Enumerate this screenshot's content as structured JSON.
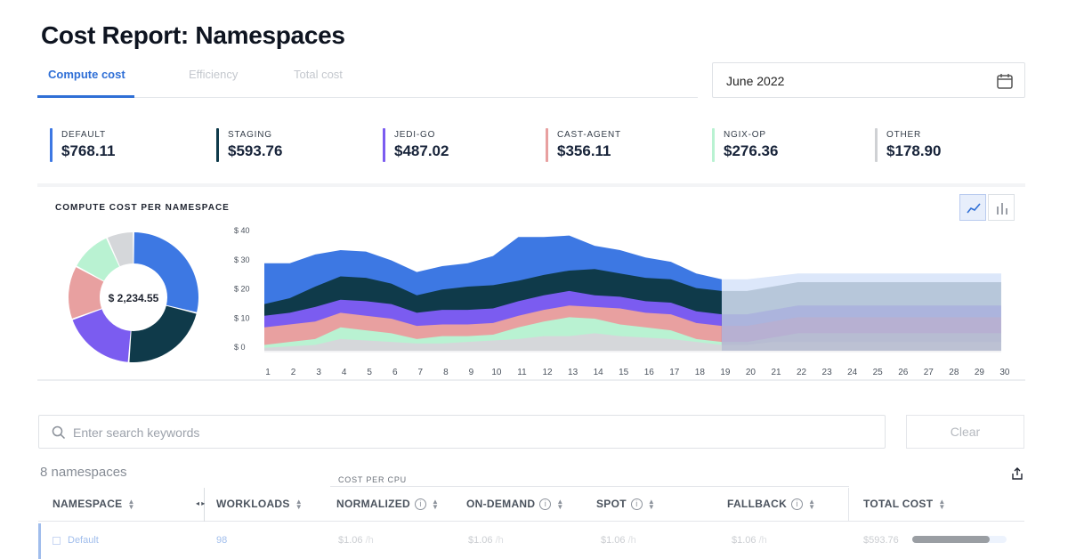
{
  "page": {
    "title": "Cost Report: Namespaces"
  },
  "tabs": [
    {
      "label": "Compute cost",
      "active": true
    },
    {
      "label": "Efficiency",
      "active": false
    },
    {
      "label": "Total cost",
      "active": false
    }
  ],
  "date_picker": {
    "value": "June 2022",
    "icon": "calendar-icon"
  },
  "summary": [
    {
      "label": "DEFAULT",
      "amount": "$768.11",
      "color": "#3d78e3"
    },
    {
      "label": "STAGING",
      "amount": "$593.76",
      "color": "#0f3a4a"
    },
    {
      "label": "JEDI-GO",
      "amount": "$487.02",
      "color": "#7b5cf0"
    },
    {
      "label": "CAST-AGENT",
      "amount": "$356.11",
      "color": "#e8a0a0"
    },
    {
      "label": "NGIX-OP",
      "amount": "$276.36",
      "color": "#b9f2d2"
    },
    {
      "label": "OTHER",
      "amount": "$178.90",
      "color": "#cfd1d4"
    }
  ],
  "chart": {
    "title": "COMPUTE COST PER NAMESPACE",
    "total_label": "$ 2,234.55",
    "toggles": [
      {
        "name": "line-chart-toggle",
        "icon": "line-chart-icon",
        "active": true
      },
      {
        "name": "bar-chart-toggle",
        "icon": "bar-chart-icon",
        "active": false
      }
    ]
  },
  "chart_data": [
    {
      "type": "pie",
      "variant": "donut",
      "center_label": "$ 2,234.55",
      "labels": [
        "DEFAULT",
        "STAGING",
        "JEDI-GO",
        "CAST-AGENT",
        "NGIX-OP",
        "OTHER"
      ],
      "values": [
        768.11,
        593.76,
        487.02,
        356.11,
        276.36,
        178.9
      ],
      "colors": [
        "#3d78e3",
        "#0f3a4a",
        "#7b5cf0",
        "#e8a0a0",
        "#b9f2d2",
        "#d5d7da"
      ]
    },
    {
      "type": "area",
      "stacked": true,
      "x": [
        1,
        2,
        3,
        4,
        5,
        6,
        7,
        8,
        9,
        10,
        11,
        12,
        13,
        14,
        15,
        16,
        17,
        18,
        19,
        20,
        21,
        22,
        23,
        24,
        25,
        26,
        27,
        28,
        29,
        30
      ],
      "ylim": [
        0,
        40
      ],
      "yticks": [
        "$ 0",
        "$ 10",
        "$ 20",
        "$ 30",
        "$ 40"
      ],
      "actual_through_day": 19,
      "series": [
        {
          "name": "OTHER",
          "color": "#d5d7da",
          "values": [
            1,
            1.5,
            2,
            4,
            3.5,
            3,
            2.5,
            2.5,
            3,
            3.5,
            4,
            5,
            5,
            6,
            5,
            4.5,
            4,
            3,
            2,
            2,
            3,
            3,
            3,
            3,
            3,
            3,
            3,
            3,
            3,
            3
          ]
        },
        {
          "name": "NGIX-OP",
          "color": "#b9f2d2",
          "values": [
            1,
            1.5,
            2,
            4,
            3.5,
            3,
            1.5,
            2.5,
            2,
            2,
            4,
            5,
            6.5,
            5,
            4,
            3.5,
            3,
            1,
            1,
            1,
            1.5,
            3,
            3,
            3,
            3,
            3,
            3,
            3,
            3,
            3
          ]
        },
        {
          "name": "CAST-AGENT",
          "color": "#e8a0a0",
          "values": [
            6,
            6,
            6,
            5,
            5,
            5,
            4.5,
            4,
            4,
            4,
            4,
            4,
            4,
            4,
            5.5,
            5,
            5.5,
            5.5,
            5.5,
            5.5,
            5.5,
            5.5,
            5.5,
            5.5,
            5.5,
            5.5,
            5.5,
            5.5,
            5.5,
            5.5
          ]
        },
        {
          "name": "JEDI-GO",
          "color": "#7b5cf0",
          "values": [
            4,
            4,
            5,
            4.5,
            5,
            5,
            4.5,
            5,
            5,
            5,
            5,
            5,
            5,
            4,
            4,
            4,
            4,
            4,
            4,
            4,
            4,
            4,
            4,
            4,
            4,
            4,
            4,
            4,
            4,
            4
          ]
        },
        {
          "name": "STAGING",
          "color": "#0f3a4a",
          "values": [
            4,
            5,
            7,
            8,
            8,
            7,
            6,
            7,
            8,
            8,
            7,
            7,
            7,
            9,
            8,
            8,
            8,
            8,
            8,
            8,
            8,
            8,
            8,
            8,
            8,
            8,
            8,
            8,
            8,
            8
          ]
        },
        {
          "name": "DEFAULT",
          "color": "#3d78e3",
          "values": [
            14,
            12,
            11,
            9,
            9,
            8,
            8,
            8,
            8,
            10,
            15,
            13,
            12,
            8,
            8,
            7,
            6,
            5,
            4,
            4,
            3.5,
            3,
            3,
            3,
            3,
            3,
            3,
            3,
            3,
            3
          ]
        }
      ]
    }
  ],
  "search": {
    "placeholder": "Enter search keywords",
    "value": "",
    "clear_label": "Clear"
  },
  "table": {
    "count": "8 namespaces",
    "group_label": "COST PER CPU",
    "columns": [
      {
        "label": "NAMESPACE",
        "info": false
      },
      {
        "label": "WORKLOADS",
        "info": false
      },
      {
        "label": "NORMALIZED",
        "info": true
      },
      {
        "label": "ON-DEMAND",
        "info": true
      },
      {
        "label": "SPOT",
        "info": true
      },
      {
        "label": "FALLBACK",
        "info": true
      },
      {
        "label": "TOTAL COST",
        "info": false
      }
    ],
    "rows": [
      {
        "namespace": "Default",
        "workloads": "98",
        "normalized": "$1.06",
        "on_demand": "$1.06",
        "spot": "$1.06",
        "fallback": "$1.06",
        "unit": "/h",
        "total": "$593.76",
        "share": 0.82
      }
    ]
  }
}
